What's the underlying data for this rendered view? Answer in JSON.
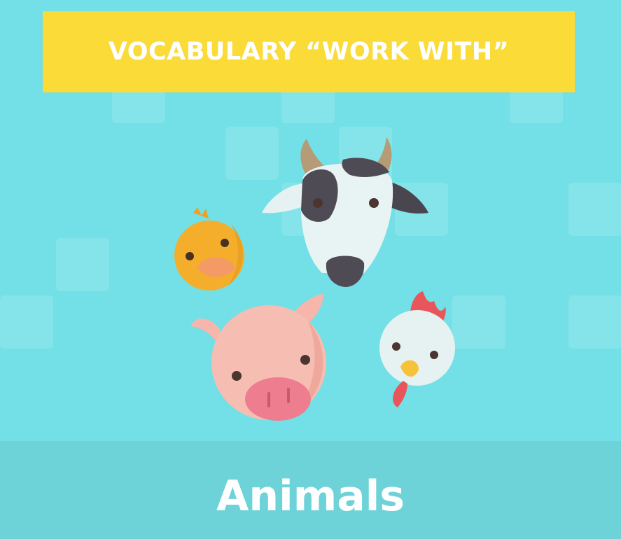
{
  "banner": {
    "title": "VOCABULARY “WORK WITH”"
  },
  "footer": {
    "title": "Animals"
  },
  "colors": {
    "background": "#72e0e6",
    "banner": "#fadb37",
    "footer": "#6dd3d9",
    "text": "#ffffff"
  },
  "illustrations": [
    "cow-icon",
    "chick-icon",
    "pig-icon",
    "chicken-icon"
  ]
}
